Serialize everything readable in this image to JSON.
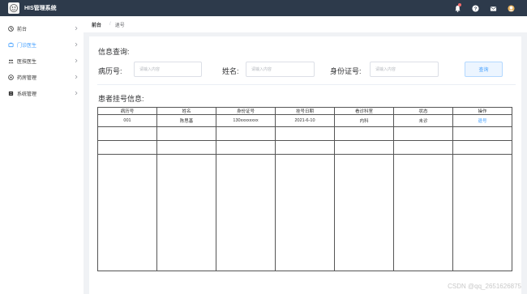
{
  "header": {
    "app_title": "HIS管理系统",
    "icons": [
      "bell-icon",
      "help-icon",
      "mail-icon",
      "avatar-icon"
    ],
    "colors": {
      "topbar": "#2d3a4b",
      "accent": "#409eff"
    }
  },
  "sidebar": {
    "items": [
      {
        "label": "前台",
        "icon": "front-desk-icon",
        "active": false
      },
      {
        "label": "门诊医生",
        "icon": "doctor-icon",
        "active": true
      },
      {
        "label": "医技医生",
        "icon": "tech-doctor-icon",
        "active": false
      },
      {
        "label": "药房管理",
        "icon": "pharmacy-icon",
        "active": false
      },
      {
        "label": "系统管理",
        "icon": "system-icon",
        "active": false
      }
    ]
  },
  "breadcrumb": {
    "home": "前台",
    "separator": "/",
    "current": "退号"
  },
  "query": {
    "title": "信息查询:",
    "fields": [
      {
        "label": "病历号:",
        "placeholder": "请输入内容"
      },
      {
        "label": "姓名:",
        "placeholder": "请输入内容"
      },
      {
        "label": "身份证号:",
        "placeholder": "请输入内容"
      }
    ],
    "button": "查询"
  },
  "register": {
    "title": "患者挂号信息:",
    "columns": [
      "病历号",
      "姓名",
      "身份证号",
      "挂号日期",
      "看诊科室",
      "状态",
      "操作"
    ],
    "rows": [
      [
        "001",
        "陈思基",
        "130xxxxxxxx",
        "2021-6-10",
        "内科",
        "未诊",
        "退号"
      ]
    ]
  },
  "watermark": "CSDN @qq_2651626875"
}
